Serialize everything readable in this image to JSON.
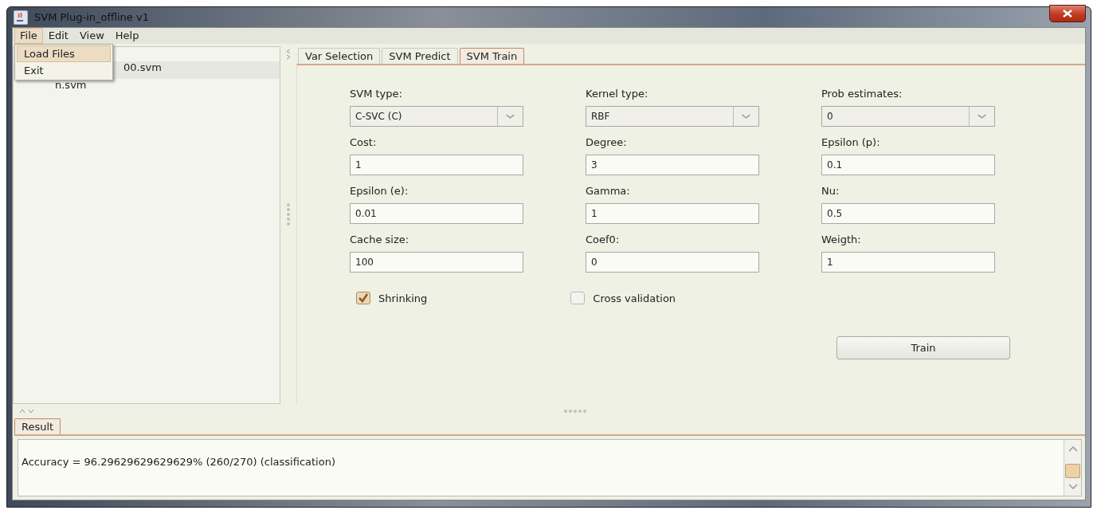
{
  "window": {
    "title": "SVM Plug-in_offline v1"
  },
  "menu_bar": [
    {
      "label": "File",
      "selected": true
    },
    {
      "label": "Edit",
      "selected": false
    },
    {
      "label": "View",
      "selected": false
    },
    {
      "label": "Help",
      "selected": false
    }
  ],
  "file_menu": [
    {
      "label": "Load Files",
      "selected": true
    },
    {
      "label": "Exit",
      "selected": false
    }
  ],
  "sidebar": {
    "items": [
      {
        "label": "00.svm",
        "selected": true
      },
      {
        "label": "n.svm",
        "selected": false
      }
    ]
  },
  "tabs": [
    {
      "label": "Var Selection",
      "selected": false
    },
    {
      "label": "SVM Predict",
      "selected": false
    },
    {
      "label": "SVM Train",
      "selected": true
    }
  ],
  "fields": [
    {
      "label": "SVM type:",
      "kind": "select",
      "value": "C-SVC (C)"
    },
    {
      "label": "Kernel type:",
      "kind": "select",
      "value": "RBF"
    },
    {
      "label": "Prob estimates:",
      "kind": "select",
      "value": "0"
    },
    {
      "label": "Cost:",
      "kind": "text",
      "value": "1"
    },
    {
      "label": "Degree:",
      "kind": "text",
      "value": "3"
    },
    {
      "label": "Epsilon (p):",
      "kind": "text",
      "value": "0.1"
    },
    {
      "label": "Epsilon (e):",
      "kind": "text",
      "value": "0.01"
    },
    {
      "label": "Gamma:",
      "kind": "text",
      "value": "1"
    },
    {
      "label": "Nu:",
      "kind": "text",
      "value": "0.5"
    },
    {
      "label": "Cache size:",
      "kind": "text",
      "value": "100"
    },
    {
      "label": "Coef0:",
      "kind": "text",
      "value": "0"
    },
    {
      "label": "Weigth:",
      "kind": "text",
      "value": "1"
    }
  ],
  "checkboxes": [
    {
      "label": "Shrinking",
      "checked": true
    },
    {
      "label": "Cross validation",
      "checked": false
    }
  ],
  "train_button": "Train",
  "result_tab": {
    "label": "Result",
    "selected": true
  },
  "result_text": "Accuracy = 96.29629629629629% (260/270) (classification)"
}
